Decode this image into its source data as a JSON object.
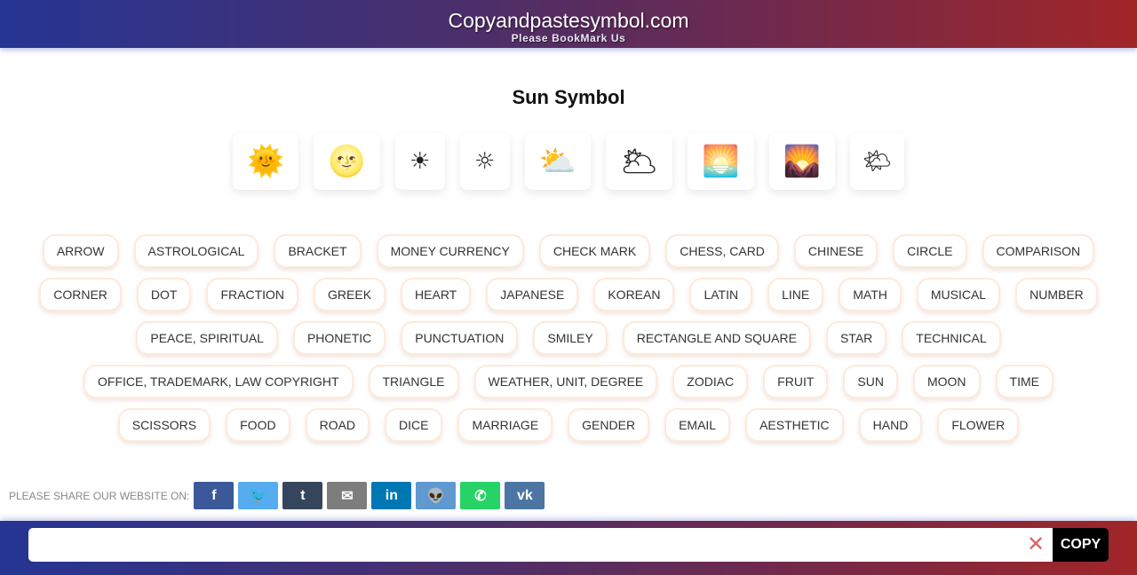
{
  "header": {
    "site_title": "Copyandpastesymbol.com",
    "tagline": "Please BookMark Us"
  },
  "page_title": "Sun Symbol",
  "symbols": [
    "🌞",
    "🌝",
    "☀",
    "☼",
    "⛅",
    "🌥",
    "🌅",
    "🌄",
    "🌤"
  ],
  "categories": [
    "ARROW",
    "ASTROLOGICAL",
    "BRACKET",
    "MONEY CURRENCY",
    "CHECK MARK",
    "CHESS, CARD",
    "CHINESE",
    "CIRCLE",
    "COMPARISON",
    "CORNER",
    "DOT",
    "FRACTION",
    "GREEK",
    "HEART",
    "JAPANESE",
    "KOREAN",
    "LATIN",
    "LINE",
    "MATH",
    "MUSICAL",
    "NUMBER",
    "PEACE, SPIRITUAL",
    "PHONETIC",
    "PUNCTUATION",
    "SMILEY",
    "RECTANGLE AND SQUARE",
    "STAR",
    "TECHNICAL",
    "OFFICE, TRADEMARK, LAW COPYRIGHT",
    "TRIANGLE",
    "WEATHER, UNIT, DEGREE",
    "ZODIAC",
    "FRUIT",
    "SUN",
    "MOON",
    "TIME",
    "SCISSORS",
    "FOOD",
    "ROAD",
    "DICE",
    "MARRIAGE",
    "GENDER",
    "EMAIL",
    "AESTHETIC",
    "HAND",
    "FLOWER"
  ],
  "share": {
    "label": "PLEASE SHARE OUR WEBSITE ON:",
    "buttons": [
      {
        "name": "facebook",
        "glyph": "f",
        "color": "#3b5998"
      },
      {
        "name": "twitter",
        "glyph": "🐦",
        "color": "#55acee"
      },
      {
        "name": "tumblr",
        "glyph": "t",
        "color": "#35465c"
      },
      {
        "name": "email",
        "glyph": "✉",
        "color": "#7d7d7d"
      },
      {
        "name": "linkedin",
        "glyph": "in",
        "color": "#0077b5"
      },
      {
        "name": "reddit",
        "glyph": "👽",
        "color": "#5f99cf"
      },
      {
        "name": "whatsapp",
        "glyph": "✆",
        "color": "#25d366"
      },
      {
        "name": "vk",
        "glyph": "vk",
        "color": "#4c75a3"
      }
    ]
  },
  "copy_bar": {
    "input_value": "",
    "clear_icon": "✕",
    "copy_label": "COPY"
  }
}
